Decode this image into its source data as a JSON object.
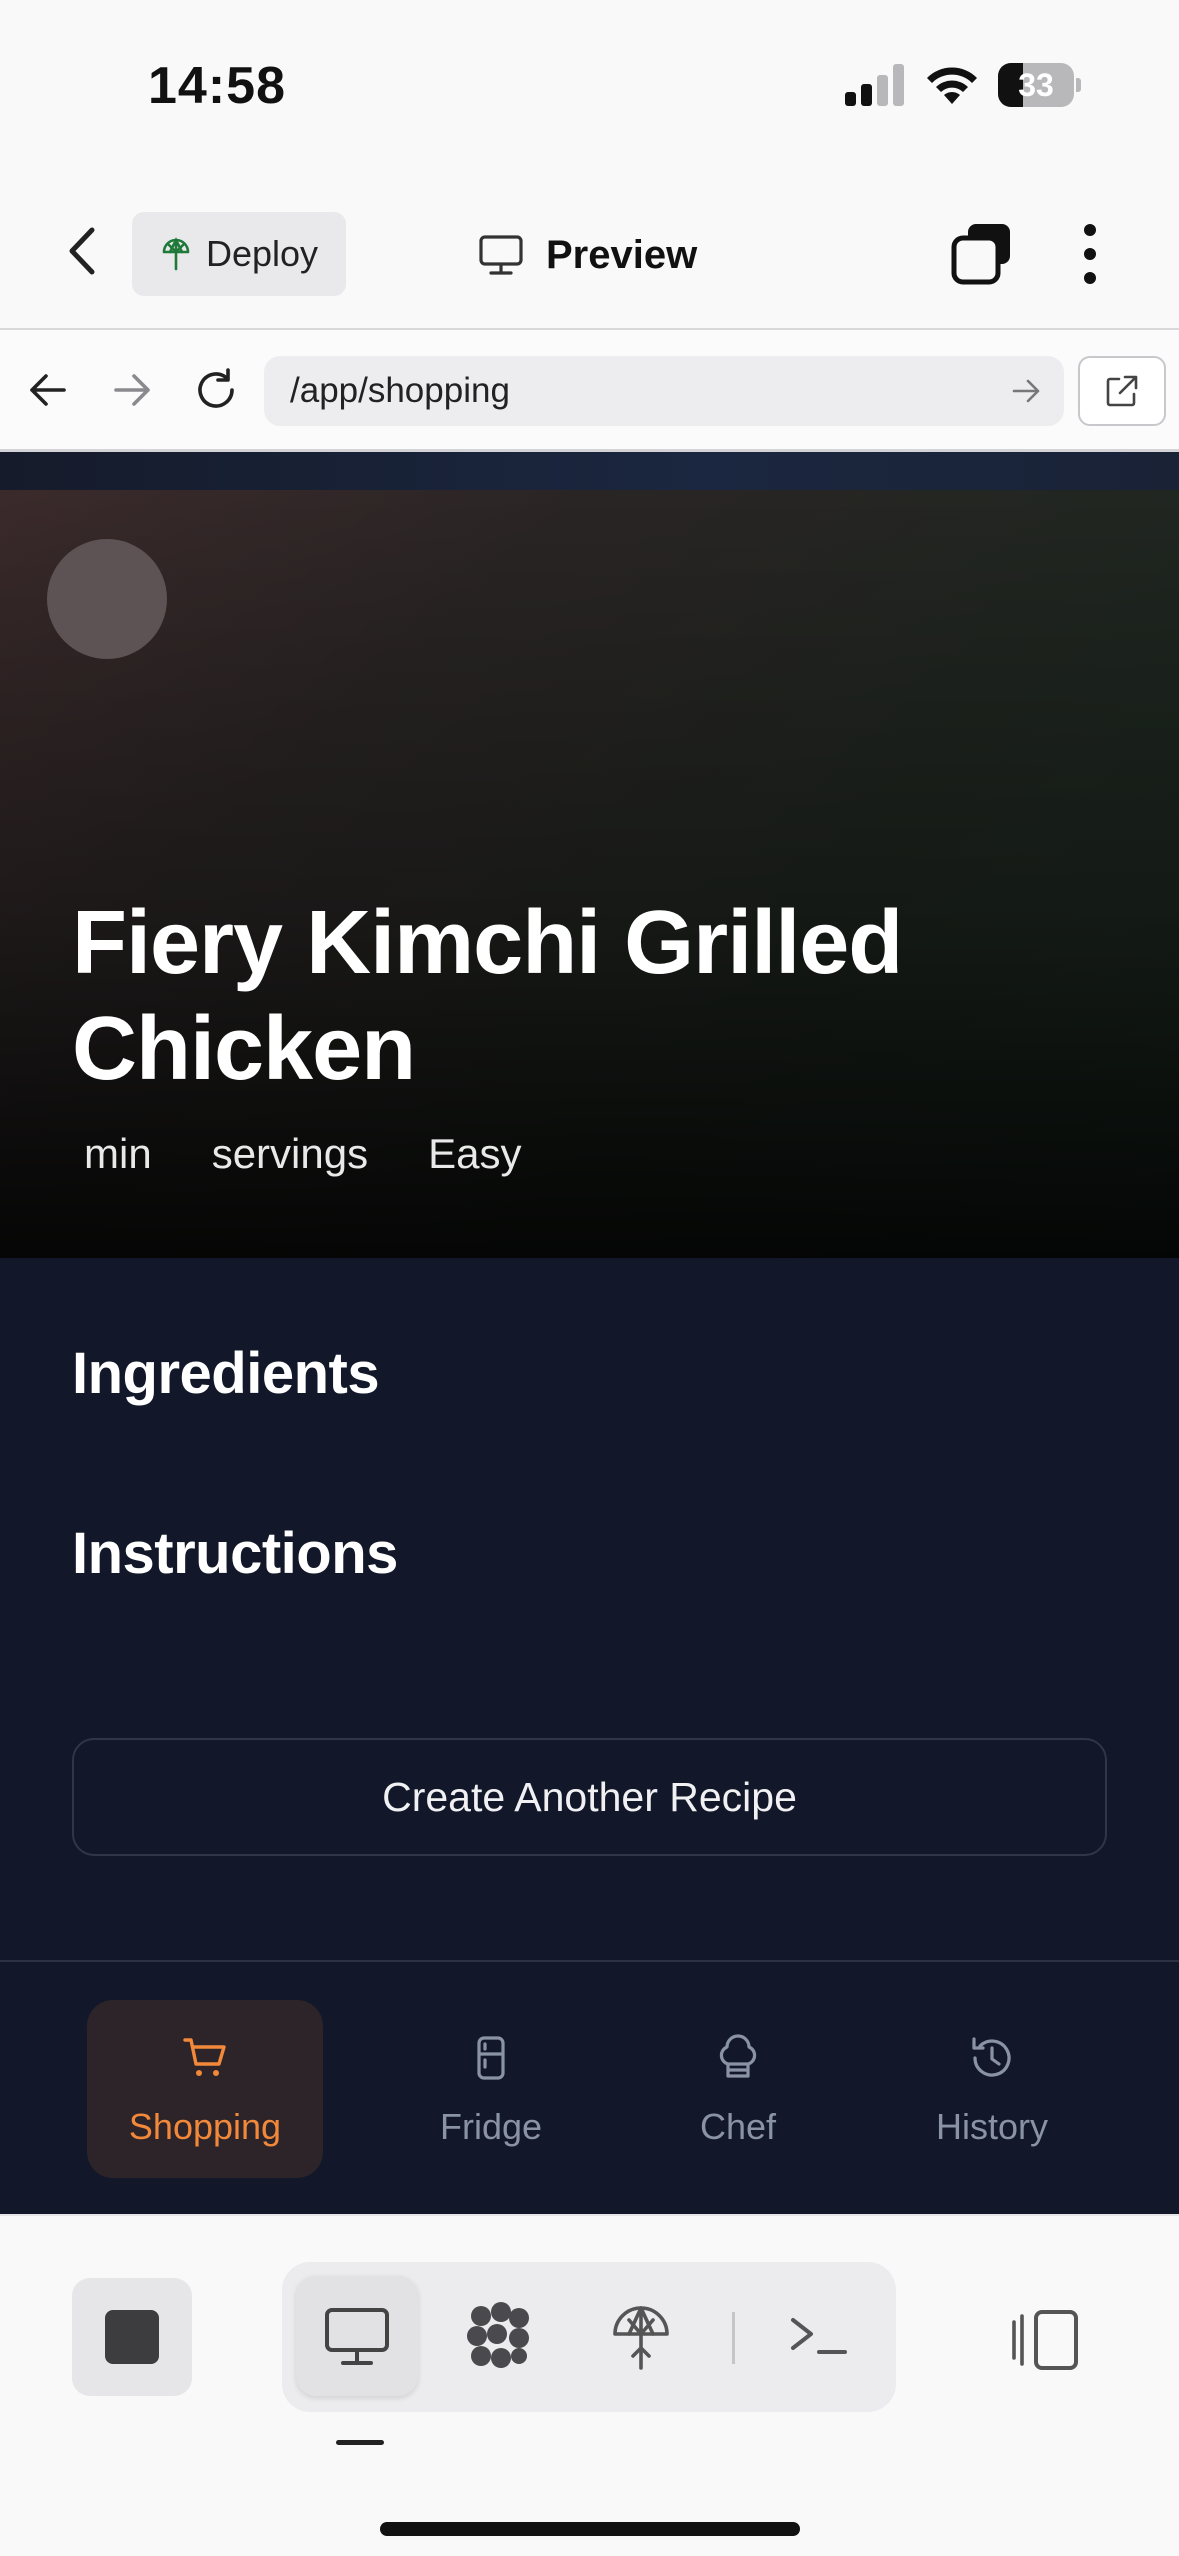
{
  "status_bar": {
    "time": "14:58",
    "battery_percent": 33,
    "battery_label": "33",
    "signal_bars": 2,
    "icons": [
      "signal-icon",
      "wifi-icon",
      "battery-icon"
    ]
  },
  "toolbar": {
    "deploy_label": "Deploy",
    "preview_label": "Preview",
    "icons": [
      "back-chevron-icon",
      "deploy-tree-icon",
      "monitor-icon",
      "copy-icon",
      "more-vertical-icon"
    ]
  },
  "browser": {
    "url": "/app/shopping",
    "icons": [
      "back-arrow-icon",
      "forward-arrow-icon",
      "reload-icon",
      "go-arrow-icon",
      "external-link-icon"
    ]
  },
  "recipe": {
    "title": "Fiery Kimchi Grilled Chicken",
    "meta": {
      "time": "min",
      "servings": "servings",
      "difficulty": "Easy"
    },
    "ingredients_heading": "Ingredients",
    "instructions_heading": "Instructions",
    "create_button": "Create Another Recipe"
  },
  "bottom_nav": {
    "active_tab": "Shopping",
    "accent_color": "#f2883a",
    "tabs": [
      {
        "label": "Shopping",
        "icon": "cart-icon"
      },
      {
        "label": "Fridge",
        "icon": "fridge-icon"
      },
      {
        "label": "Chef",
        "icon": "chef-hat-icon"
      },
      {
        "label": "History",
        "icon": "history-icon"
      }
    ]
  },
  "dock": {
    "active_item": "monitor",
    "icons": [
      "stop-icon",
      "monitor-icon",
      "agents-icon",
      "deploy-tree-icon",
      "terminal-icon",
      "panel-toggle-icon"
    ]
  }
}
